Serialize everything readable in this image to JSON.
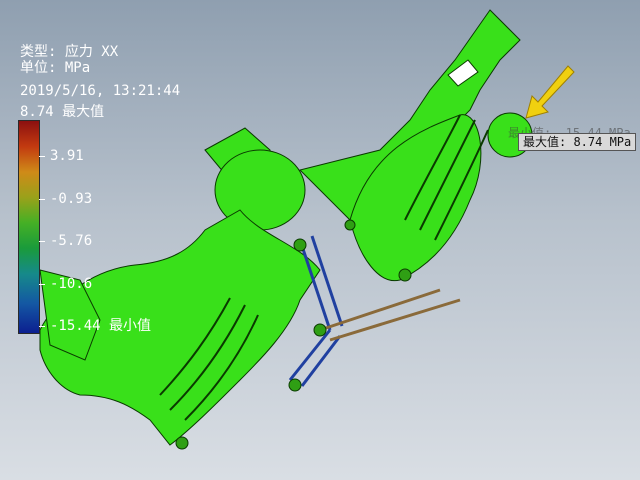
{
  "legend": {
    "type_line": "类型: 应力 XX",
    "unit_line": "单位: MPa",
    "timestamp": "2019/5/16, 13:21:44",
    "max_line": "8.74 最大值",
    "ticks": [
      "3.91",
      "-0.93",
      "-5.76",
      "-10.6",
      "-15.44 最小值"
    ],
    "colors": {
      "max": "#8c1010",
      "mid": "#45b025",
      "min": "#0c1f90"
    }
  },
  "probes": {
    "max_label": "最大值: 8.74 MPa",
    "min_label_partial": "最小值: -15.44 MPa"
  },
  "model": {
    "body_color": "#39e01a",
    "mesh_color": "#0a3a00",
    "link_color": "#2040a0",
    "rod_color": "#8a6a3a",
    "arrow_color": "#f0d010"
  }
}
